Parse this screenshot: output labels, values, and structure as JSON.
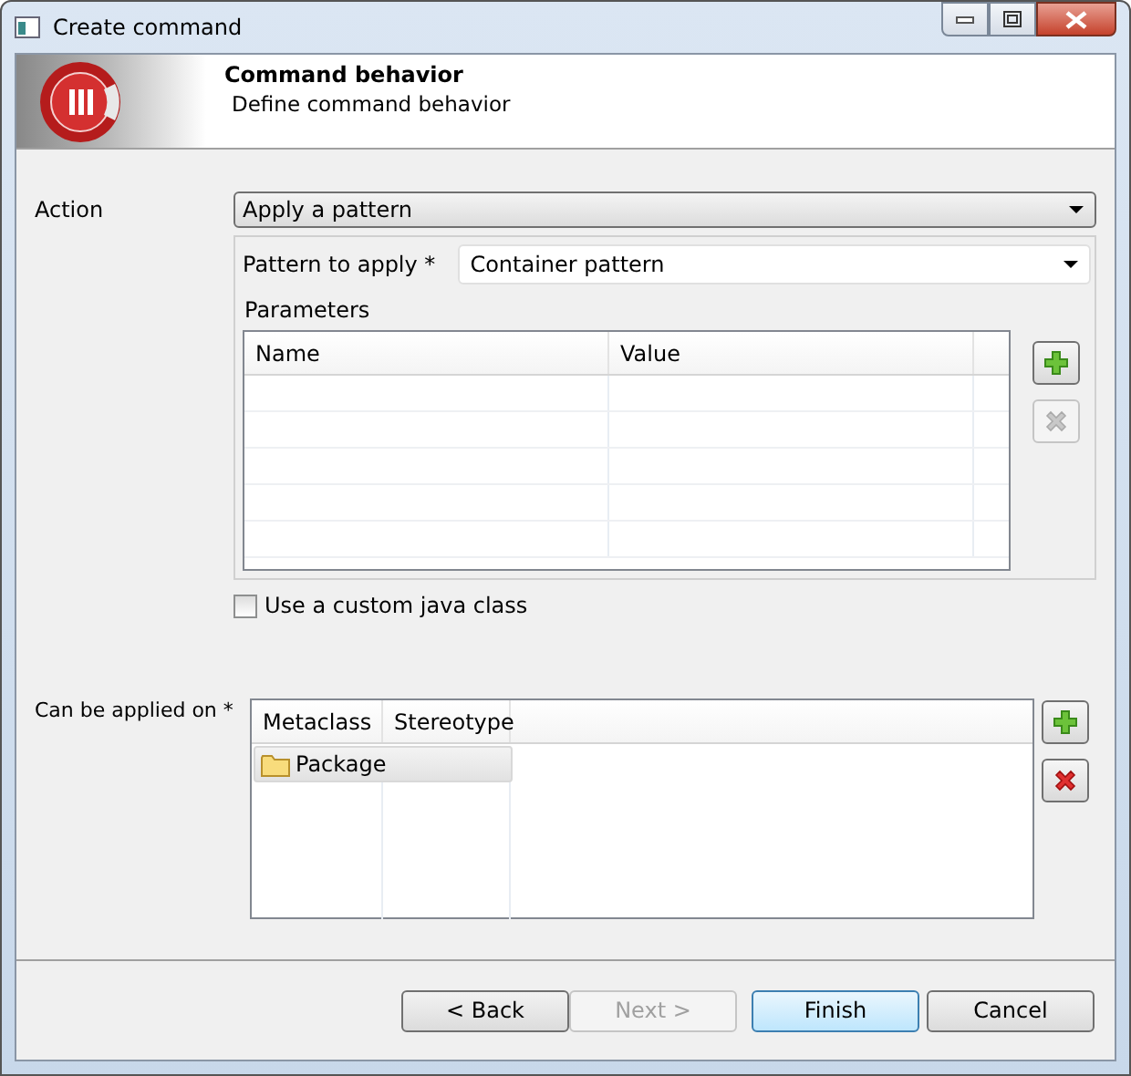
{
  "window": {
    "title": "Create command"
  },
  "header": {
    "title": "Command behavior",
    "subtitle": "Define command behavior"
  },
  "action": {
    "label": "Action",
    "value": "Apply a pattern"
  },
  "pattern": {
    "label": "Pattern to apply *",
    "value": "Container pattern"
  },
  "parameters": {
    "label": "Parameters",
    "columns": [
      "Name",
      "Value"
    ],
    "buttons": [
      {
        "kind": "add",
        "disabled": false
      },
      {
        "kind": "remove",
        "disabled": true
      }
    ]
  },
  "custom_java_class": {
    "label": "Use a custom java class",
    "checked": false
  },
  "applied_on": {
    "label": "Can be applied on *",
    "columns": [
      "Metaclass",
      "Stereotype"
    ],
    "rows": [
      {
        "metaclass": "Package",
        "selected": true
      }
    ],
    "buttons": [
      {
        "kind": "add",
        "disabled": false
      },
      {
        "kind": "remove",
        "disabled": false
      }
    ]
  },
  "buttons": [
    {
      "label": "< Back",
      "disabled": false,
      "default": false
    },
    {
      "label": "Next >",
      "disabled": true,
      "default": false
    },
    {
      "label": "Finish",
      "disabled": false,
      "default": true
    },
    {
      "label": "Cancel",
      "disabled": false,
      "default": false
    }
  ]
}
